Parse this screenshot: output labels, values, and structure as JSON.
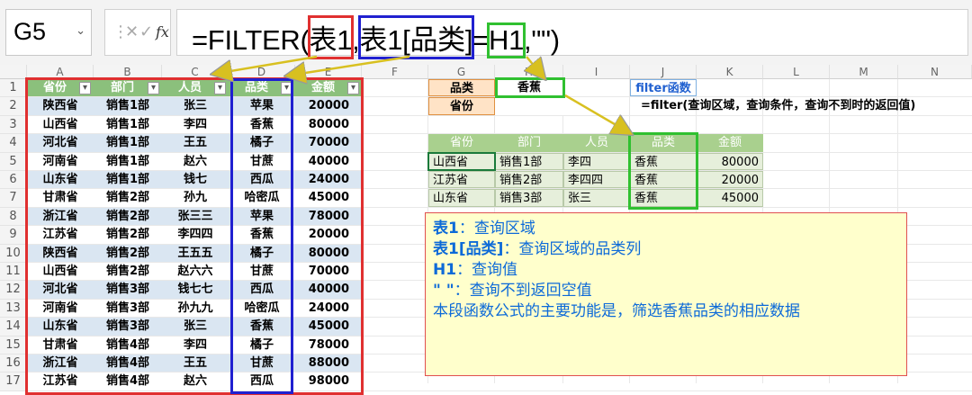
{
  "namebox": {
    "value": "G5"
  },
  "formula": {
    "parts": [
      "=FILTER(",
      "表1",
      ",",
      "表1[品类]",
      "=",
      "H1",
      ",\"\")"
    ]
  },
  "columns": [
    "A",
    "B",
    "C",
    "D",
    "E",
    "F",
    "G",
    "H",
    "I",
    "J",
    "K",
    "L",
    "M",
    "N"
  ],
  "rows": [
    "1",
    "2",
    "3",
    "4",
    "5",
    "6",
    "7",
    "8",
    "9",
    "10",
    "11",
    "12",
    "13",
    "14",
    "15",
    "16",
    "17"
  ],
  "table1": {
    "headers": [
      "省份",
      "部门",
      "人员",
      "品类",
      "金额"
    ],
    "rows": [
      [
        "陕西省",
        "销售1部",
        "张三",
        "苹果",
        "20000"
      ],
      [
        "山西省",
        "销售1部",
        "李四",
        "香蕉",
        "80000"
      ],
      [
        "河北省",
        "销售1部",
        "王五",
        "橘子",
        "70000"
      ],
      [
        "河南省",
        "销售1部",
        "赵六",
        "甘蔗",
        "40000"
      ],
      [
        "山东省",
        "销售1部",
        "钱七",
        "西瓜",
        "24000"
      ],
      [
        "甘肃省",
        "销售2部",
        "孙九",
        "哈密瓜",
        "45000"
      ],
      [
        "浙江省",
        "销售2部",
        "张三三",
        "苹果",
        "78000"
      ],
      [
        "江苏省",
        "销售2部",
        "李四四",
        "香蕉",
        "20000"
      ],
      [
        "陕西省",
        "销售2部",
        "王五五",
        "橘子",
        "80000"
      ],
      [
        "山西省",
        "销售2部",
        "赵六六",
        "甘蔗",
        "70000"
      ],
      [
        "河北省",
        "销售3部",
        "钱七七",
        "西瓜",
        "40000"
      ],
      [
        "河南省",
        "销售3部",
        "孙九九",
        "哈密瓜",
        "24000"
      ],
      [
        "山东省",
        "销售3部",
        "张三",
        "香蕉",
        "45000"
      ],
      [
        "甘肃省",
        "销售4部",
        "李四",
        "橘子",
        "78000"
      ],
      [
        "浙江省",
        "销售4部",
        "王五",
        "甘蔗",
        "88000"
      ],
      [
        "江苏省",
        "销售4部",
        "赵六",
        "西瓜",
        "98000"
      ]
    ]
  },
  "criteria": {
    "g1": "品类",
    "h1": "香蕉",
    "g2": "省份",
    "h2": ""
  },
  "func_label": "filter函数",
  "func_syntax": "=filter(查询区域，查询条件，查询不到时的返回值)",
  "result": {
    "headers": [
      "省份",
      "部门",
      "人员",
      "品类",
      "金额"
    ],
    "rows": [
      [
        "山西省",
        "销售1部",
        "李四",
        "香蕉",
        "80000"
      ],
      [
        "江苏省",
        "销售2部",
        "李四四",
        "香蕉",
        "20000"
      ],
      [
        "山东省",
        "销售3部",
        "张三",
        "香蕉",
        "45000"
      ]
    ]
  },
  "note": {
    "l1_key": "表1",
    "l1_val": "：查询区域",
    "l2_key": "表1[品类]",
    "l2_val": "：查询区域的品类列",
    "l3_key": "H1",
    "l3_val": "：查询值",
    "l4_key": "\" \"",
    "l4_val": "：查询不到返回空值",
    "l5": "本段函数公式的主要功能是，筛选香蕉品类的相应数据"
  },
  "colors": {
    "red": "#e03030",
    "blue": "#2020d0",
    "green": "#30c030",
    "header_green": "#8bc07c",
    "band_blue": "#dae6f2",
    "note_bg": "#ffffcc",
    "note_text": "#0d6ad8"
  }
}
